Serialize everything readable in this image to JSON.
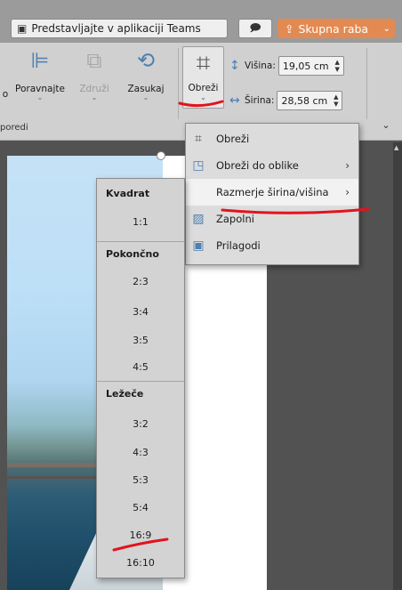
{
  "titlebar": {
    "teams_label": "Predstavljajte v aplikaciji Teams",
    "share_label": "Skupna raba"
  },
  "ribbon": {
    "partial_label": "o",
    "align_label": "Poravnajte",
    "group_label_disabled": "Združi",
    "rotate_label": "Zasukaj",
    "crop_label": "Obreži",
    "height_label": "Višina:",
    "height_value": "19,05 cm",
    "width_label": "Širina:",
    "width_value": "28,58 cm",
    "section_label": "poredi"
  },
  "crop_menu": {
    "items": [
      {
        "label": "Obreži",
        "icon": "crop-icon"
      },
      {
        "label": "Obreži do oblike",
        "icon": "shape-icon"
      },
      {
        "label": "Razmerje širina/višina",
        "icon": "none"
      },
      {
        "label": "Zapolni",
        "icon": "fill-icon"
      },
      {
        "label": "Prilagodi",
        "icon": "fit-icon"
      }
    ]
  },
  "ratio_menu": {
    "square_header": "Kvadrat",
    "square": [
      "1:1"
    ],
    "portrait_header": "Pokončno",
    "portrait": [
      "2:3",
      "3:4",
      "3:5",
      "4:5"
    ],
    "landscape_header": "Ležeče",
    "landscape": [
      "3:2",
      "4:3",
      "5:3",
      "5:4",
      "16:9",
      "16:10"
    ]
  },
  "colors": {
    "accent": "#4d7fb0",
    "share_button": "#e28a52",
    "annotation": "#e0141e"
  }
}
